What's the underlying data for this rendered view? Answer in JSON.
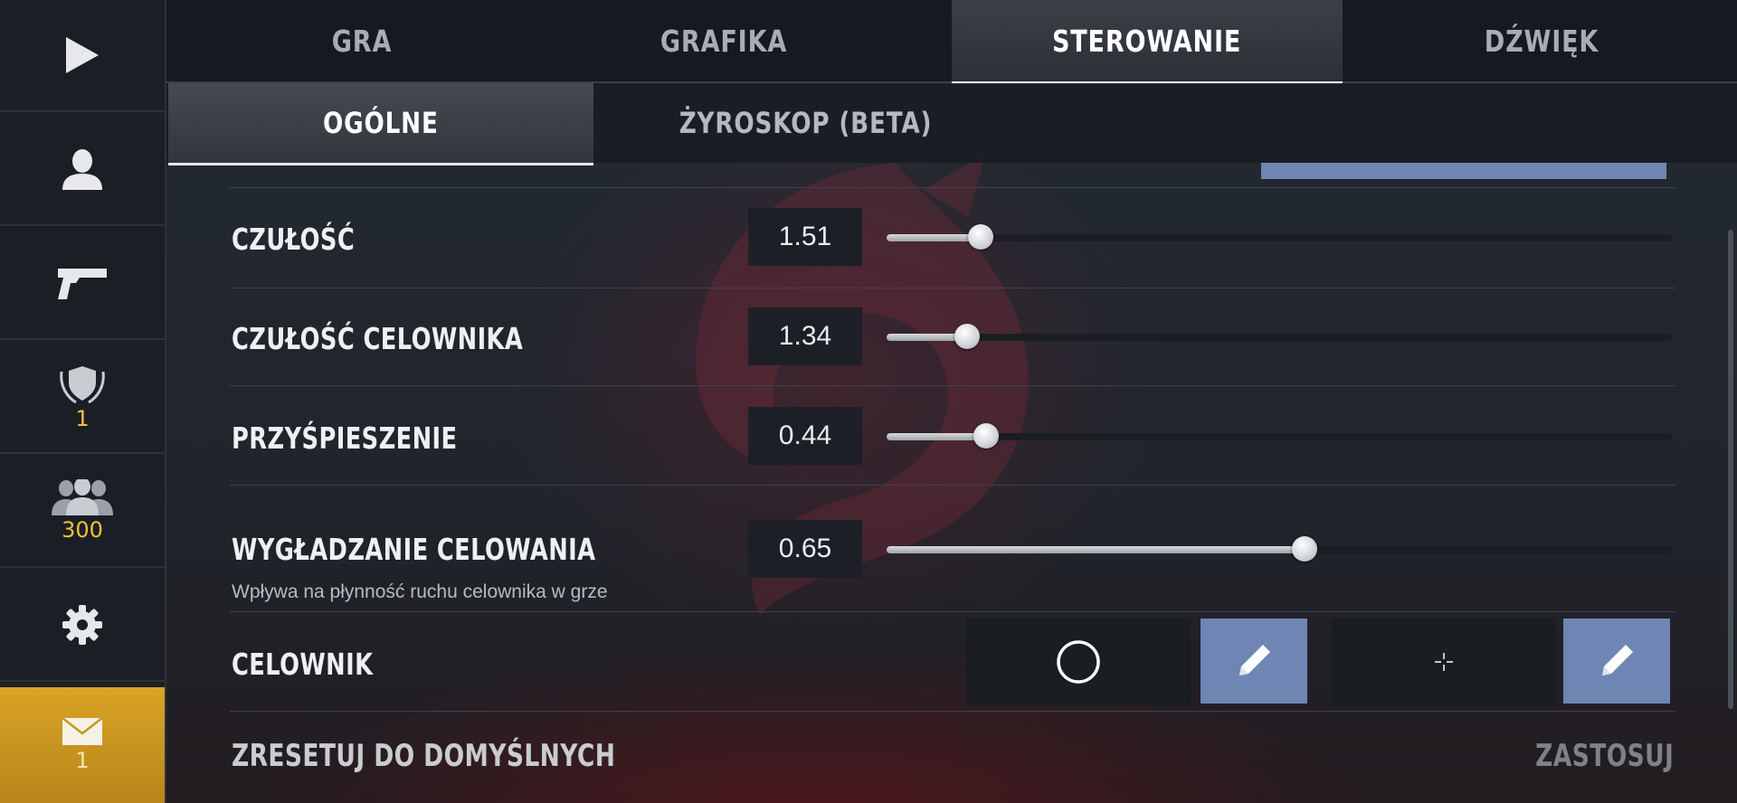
{
  "tabs": [
    {
      "label": "GRA",
      "active": false
    },
    {
      "label": "GRAFIKA",
      "active": false
    },
    {
      "label": "STEROWANIE",
      "active": true
    },
    {
      "label": "DŹWIĘK",
      "active": false
    }
  ],
  "subtabs": [
    {
      "label": "OGÓLNE",
      "active": true
    },
    {
      "label": "ŻYROSKOP (BETA)",
      "active": false
    }
  ],
  "sidebar": {
    "items": [
      {
        "icon": "play-icon",
        "badge": ""
      },
      {
        "icon": "profile-icon",
        "badge": ""
      },
      {
        "icon": "pistol-icon",
        "badge": ""
      },
      {
        "icon": "rank-shield-icon",
        "badge": "1"
      },
      {
        "icon": "friends-icon",
        "badge": "300"
      },
      {
        "icon": "gear-icon",
        "badge": ""
      },
      {
        "icon": "mail-icon",
        "badge": "1"
      }
    ]
  },
  "settings": {
    "sensitivity": {
      "label": "CZUŁOŚĆ",
      "value": "1.51",
      "fraction": 0.12
    },
    "scope_sensitivity": {
      "label": "CZUŁOŚĆ CELOWNIKA",
      "value": "1.34",
      "fraction": 0.103
    },
    "acceleration": {
      "label": "PRZYŚPIESZENIE",
      "value": "0.44",
      "fraction": 0.127
    },
    "aim_smoothing": {
      "label": "WYGŁADZANIE CELOWANIA",
      "value": "0.65",
      "fraction": 0.532,
      "description": "Wpływa na płynność ruchu celownika w grze"
    },
    "crosshair": {
      "label": "CELOWNIK"
    }
  },
  "footer": {
    "reset_label": "ZRESETUJ DO DOMYŚLNYCH",
    "apply_label": "ZASTOSUJ"
  },
  "colors": {
    "accent_blue": "#6f86b4",
    "mail_gold": "#d9a326",
    "badge_yellow": "#f0c23a"
  }
}
